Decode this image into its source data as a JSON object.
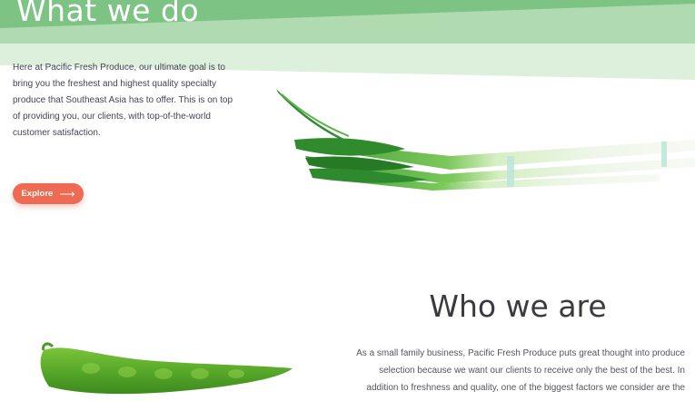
{
  "hero": {
    "title": "What we do",
    "intro": "Here at Pacific Fresh Produce, our ultimate goal is to bring you the freshest and highest quality specialty produce that Southeast Asia has to offer. This is on top of providing you, our clients, with top-of-the-world customer satisfaction.",
    "button_label": "Explore",
    "button_icon": "arrow-right-icon"
  },
  "about": {
    "title": "Who we are",
    "text": "As a small family business, Pacific Fresh Produce puts great thought into produce selection because we want our clients to receive only the best of the best. In addition to freshness and quality, one of the biggest factors we consider are the"
  },
  "colors": {
    "banner_dark": "#7dc384",
    "banner_mid": "#b0dbb0",
    "banner_light": "#ddf0dc",
    "accent": "#ee6a52"
  }
}
